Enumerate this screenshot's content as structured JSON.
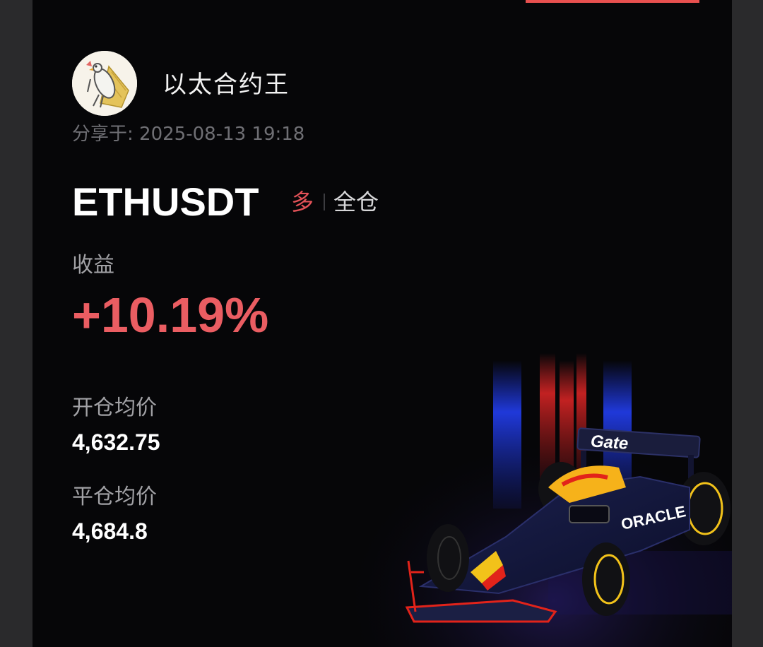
{
  "user": {
    "name": "以太合约王",
    "avatar_icon": "cartoon-bird-avatar"
  },
  "share": {
    "label": "分享于:",
    "datetime": "2025-08-13 19:18"
  },
  "position": {
    "symbol": "ETHUSDT",
    "side": "多",
    "margin_mode": "全仓"
  },
  "profit": {
    "label": "收益",
    "value": "+10.19%"
  },
  "open_price": {
    "label": "开仓均价",
    "value": "4,632.75"
  },
  "close_price": {
    "label": "平仓均价",
    "value": "4,684.8"
  },
  "art": {
    "icon": "racing-car-illustration",
    "sponsor_text": "Gate",
    "secondary_text": "ORACLE"
  },
  "colors": {
    "background": "#060608",
    "accent_red": "#ea5d62",
    "side_red": "#e35258",
    "muted_text": "#a2a2a6"
  }
}
